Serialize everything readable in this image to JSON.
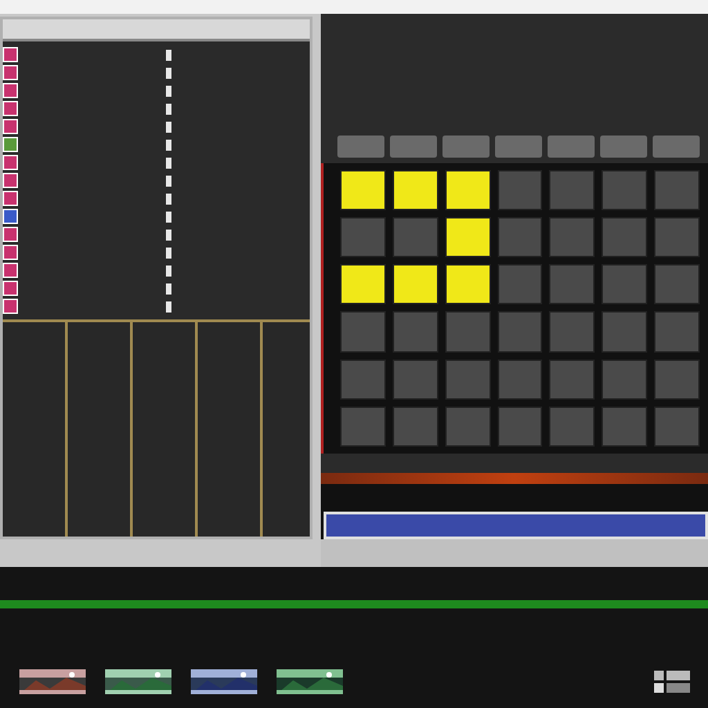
{
  "track_list": {
    "rows": [
      {
        "color": "#c8326e",
        "selected": false
      },
      {
        "color": "#c8326e",
        "selected": false
      },
      {
        "color": "#c8326e",
        "selected": false
      },
      {
        "color": "#c8326e",
        "selected": false
      },
      {
        "color": "#c8326e",
        "selected": false
      },
      {
        "color": "#5a9a3a",
        "selected": false
      },
      {
        "color": "#c8326e",
        "selected": false
      },
      {
        "color": "#c8326e",
        "selected": false
      },
      {
        "color": "#c8326e",
        "selected": false
      },
      {
        "color": "#3a5ac8",
        "selected": false
      },
      {
        "color": "#c8326e",
        "selected": false
      },
      {
        "color": "#c8326e",
        "selected": false
      },
      {
        "color": "#c8326e",
        "selected": false
      },
      {
        "color": "#c8326e",
        "selected": false
      },
      {
        "color": "#c8326e",
        "selected": false
      }
    ]
  },
  "pad_grid": {
    "rows": [
      {
        "pads": [
          {
            "lit": true
          },
          {
            "lit": true
          },
          {
            "lit": true
          },
          {
            "lit": false
          },
          {
            "lit": false
          },
          {
            "lit": false
          },
          {
            "lit": false
          }
        ]
      },
      {
        "pads": [
          {
            "lit": false
          },
          {
            "lit": false
          },
          {
            "lit": true
          },
          {
            "lit": false
          },
          {
            "lit": false
          },
          {
            "lit": false
          },
          {
            "lit": false
          }
        ]
      },
      {
        "pads": [
          {
            "lit": true
          },
          {
            "lit": true
          },
          {
            "lit": true
          },
          {
            "lit": false
          },
          {
            "lit": false
          },
          {
            "lit": false
          },
          {
            "lit": false
          }
        ]
      },
      {
        "pads": [
          {
            "lit": false
          },
          {
            "lit": false
          },
          {
            "lit": false
          },
          {
            "lit": false
          },
          {
            "lit": false
          },
          {
            "lit": false
          },
          {
            "lit": false
          }
        ]
      },
      {
        "pads": [
          {
            "lit": false
          },
          {
            "lit": false
          },
          {
            "lit": false
          },
          {
            "lit": false
          },
          {
            "lit": false
          },
          {
            "lit": false
          },
          {
            "lit": false
          }
        ]
      },
      {
        "pads": [
          {
            "lit": false
          },
          {
            "lit": false
          },
          {
            "lit": false
          },
          {
            "lit": false
          },
          {
            "lit": false
          },
          {
            "lit": false
          },
          {
            "lit": false
          }
        ]
      }
    ]
  }
}
